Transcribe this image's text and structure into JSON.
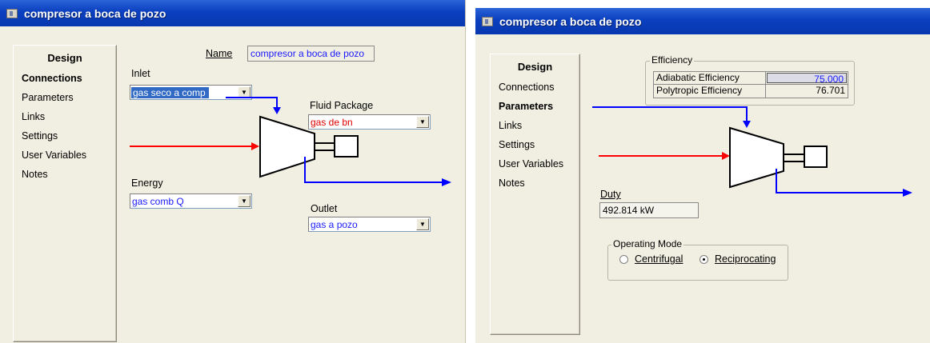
{
  "left": {
    "title": "compresor a boca de pozo",
    "nav": {
      "heading": "Design",
      "items": [
        {
          "label": "Connections",
          "active": true
        },
        {
          "label": "Parameters",
          "active": false
        },
        {
          "label": "Links",
          "active": false
        },
        {
          "label": "Settings",
          "active": false
        },
        {
          "label": "User Variables",
          "active": false
        },
        {
          "label": "Notes",
          "active": false
        }
      ]
    },
    "name_label": "Name",
    "name_value": "compresor a boca de pozo",
    "inlet": {
      "label": "Inlet",
      "value": "gas seco a comp"
    },
    "fluid_package": {
      "label": "Fluid Package",
      "value": "gas de bn"
    },
    "energy": {
      "label": "Energy",
      "value": "gas comb Q"
    },
    "outlet": {
      "label": "Outlet",
      "value": "gas a pozo"
    }
  },
  "right": {
    "title": "compresor a boca de pozo",
    "nav": {
      "heading": "Design",
      "items": [
        {
          "label": "Connections",
          "active": false
        },
        {
          "label": "Parameters",
          "active": true
        },
        {
          "label": "Links",
          "active": false
        },
        {
          "label": "Settings",
          "active": false
        },
        {
          "label": "User Variables",
          "active": false
        },
        {
          "label": "Notes",
          "active": false
        }
      ]
    },
    "efficiency": {
      "legend": "Efficiency",
      "rows": [
        {
          "name": "Adiabatic Efficiency",
          "value": "75.000"
        },
        {
          "name": "Polytropic Efficiency",
          "value": "76.701"
        }
      ]
    },
    "duty": {
      "label": "Duty",
      "value": "492.814 kW"
    },
    "operating_mode": {
      "legend": "Operating Mode",
      "options": [
        {
          "label": "Centrifugal",
          "selected": false
        },
        {
          "label": "Reciprocating",
          "selected": true
        }
      ]
    }
  },
  "colors": {
    "title_bar": "#0a3fbf",
    "material_stream_feed": "#ff0000",
    "material_stream_product": "#0000ff",
    "energy_stream": "#0000ff",
    "fluid_package_text": "#e00000",
    "link_text": "#1a1aff",
    "selection_highlight": "#316ac5"
  },
  "icons": [
    "window-icon",
    "dropdown-arrow-icon",
    "compressor-icon",
    "radio-button-icon"
  ]
}
